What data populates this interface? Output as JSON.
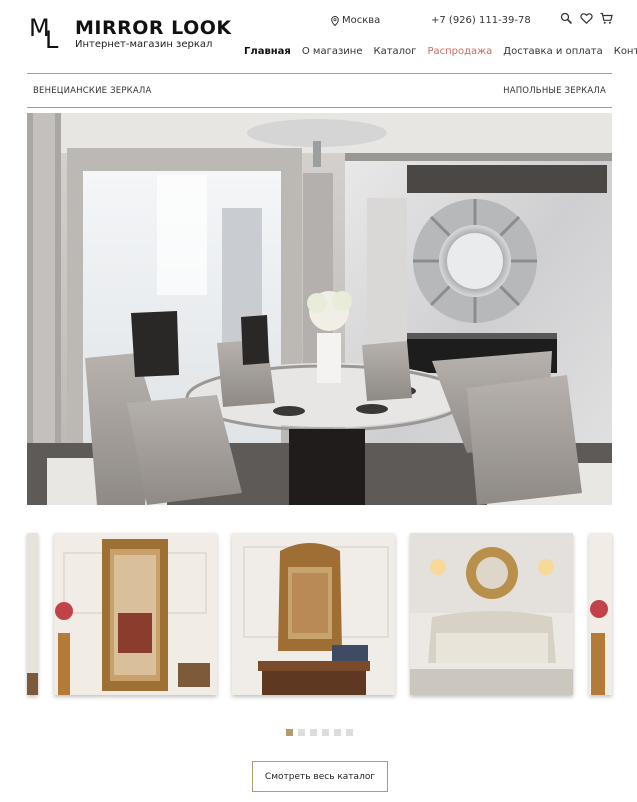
{
  "header": {
    "logo_m": "M",
    "logo_l": "L",
    "brand": "MIRROR LOOK",
    "tagline": "Интернет-магазин зеркал",
    "city": "Москва",
    "phone": "+7 (926) 111-39-78",
    "icons": [
      "search-icon",
      "heart-icon",
      "cart-icon"
    ]
  },
  "nav": {
    "items": [
      {
        "label": "Главная"
      },
      {
        "label": "О магазине"
      },
      {
        "label": "Каталог"
      },
      {
        "label": "Распродажа"
      },
      {
        "label": "Доставка и оплата"
      },
      {
        "label": "Контакты"
      }
    ]
  },
  "subnav": {
    "left": "ВЕНЕЦИАНСКИЕ ЗЕРКАЛА",
    "right": "НАПОЛЬНЫЕ ЗЕРКАЛА"
  },
  "carousel": {
    "dots_count": 6,
    "active_dot": 1
  },
  "cta": {
    "label": "Смотреть весь каталог"
  },
  "colors": {
    "accent": "#b59a6a",
    "sale": "#c96a5e"
  }
}
